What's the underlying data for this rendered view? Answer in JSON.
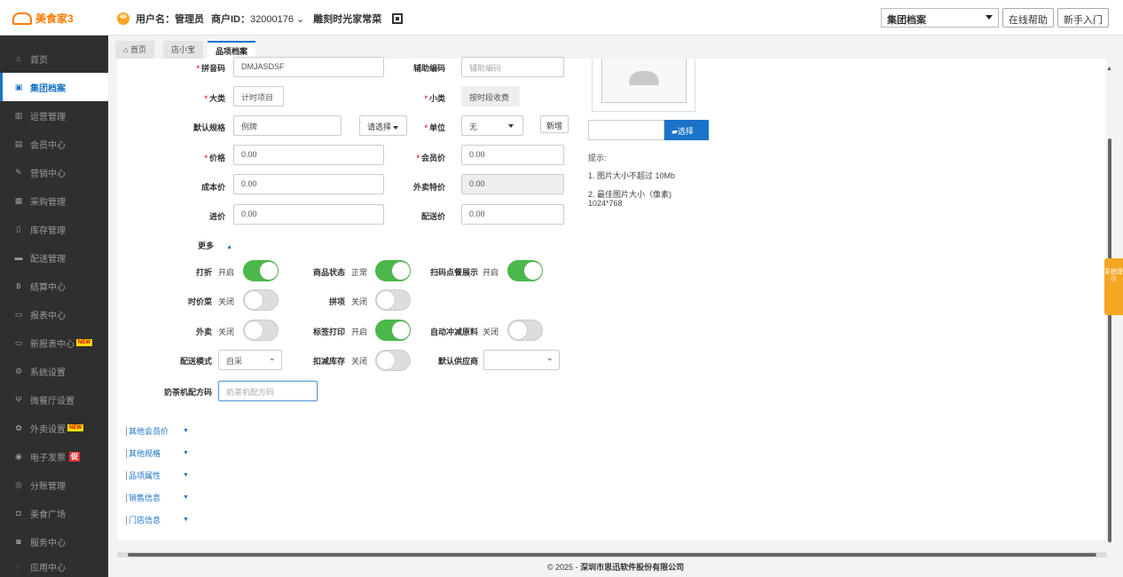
{
  "app": {
    "name": "美食家3"
  },
  "header": {
    "user_label": "用户名：",
    "user_name": "管理员",
    "merchant_label": "商户ID：",
    "merchant_id": "32000176",
    "store_name": "雕刻时光家常菜",
    "module_select": "集团档案",
    "help_button": "在线帮助",
    "guide_button": "新手入门",
    "icons": {
      "avatar": "user-icon",
      "qr": "qr-code-icon",
      "logo": "cloud-logo"
    }
  },
  "sidebar": {
    "items": [
      {
        "icon": "⌂",
        "label": "首页"
      },
      {
        "icon": "▣",
        "label": "集团档案",
        "active": true
      },
      {
        "icon": "▥",
        "label": "运营管理"
      },
      {
        "icon": "▤",
        "label": "会员中心"
      },
      {
        "icon": "✎",
        "label": "营销中心"
      },
      {
        "icon": "▦",
        "label": "采购管理"
      },
      {
        "icon": "▯",
        "label": "库存管理"
      },
      {
        "icon": "▬",
        "label": "配送管理"
      },
      {
        "icon": "฿",
        "label": "结算中心"
      },
      {
        "icon": "▭",
        "label": "报表中心"
      },
      {
        "icon": "▭",
        "label": "新报表中心",
        "badge": "NEW"
      },
      {
        "icon": "⚙",
        "label": "系统设置"
      },
      {
        "icon": "Ψ",
        "label": "微餐厅设置"
      },
      {
        "icon": "✿",
        "label": "外卖设置",
        "badge": "NEW"
      },
      {
        "icon": "◉",
        "label": "电子发票",
        "promo": "促"
      },
      {
        "icon": "◎",
        "label": "分账管理"
      },
      {
        "icon": "◘",
        "label": "美食广场"
      },
      {
        "icon": "◙",
        "label": "服务中心"
      },
      {
        "icon": "◌",
        "label": "应用中心"
      }
    ]
  },
  "tabs": [
    {
      "label": "首页",
      "icon": "⌂"
    },
    {
      "label": "店小宝"
    },
    {
      "label": "品项档案",
      "active": true
    }
  ],
  "form": {
    "pinyin": {
      "label": "拼音码",
      "value": "DMJASDSF"
    },
    "aux_code": {
      "label": "辅助编码",
      "placeholder": "辅助编码"
    },
    "category": {
      "label": "大类",
      "value": "计时项目"
    },
    "subcategory": {
      "label": "小类",
      "value": "按时段收费"
    },
    "default_spec": {
      "label": "默认规格",
      "value": "例牌",
      "select_button": "请选择"
    },
    "unit": {
      "label": "单位",
      "value": "无",
      "new_button": "新增"
    },
    "price": {
      "label": "价格",
      "value": "0.00"
    },
    "member_price": {
      "label": "会员价",
      "value": "0.00"
    },
    "cost_price": {
      "label": "成本价",
      "value": "0.00"
    },
    "takeout_price": {
      "label": "外卖特价",
      "value": "0.00"
    },
    "purchase_price": {
      "label": "进价",
      "value": "0.00"
    },
    "delivery_price": {
      "label": "配送价",
      "value": "0.00"
    },
    "more": {
      "label": "更多",
      "arrow": "▲"
    },
    "toggles": [
      {
        "label": "打折",
        "state": "开启",
        "on": true
      },
      {
        "label": "商品状态",
        "state": "正常",
        "on": true
      },
      {
        "label": "扫码点餐展示",
        "state": "开启",
        "on": true
      },
      {
        "label": "时价菜",
        "state": "关闭",
        "on": false
      },
      {
        "label": "拼项",
        "state": "关闭",
        "on": false
      },
      {
        "label": "外卖",
        "state": "关闭",
        "on": false
      },
      {
        "label": "标签打印",
        "state": "开启",
        "on": true
      },
      {
        "label": "自动冲减原料",
        "state": "关闭",
        "on": false
      },
      {
        "label": "扣减库存",
        "state": "关闭",
        "on": false
      }
    ],
    "delivery_mode": {
      "label": "配送模式",
      "value": "自采"
    },
    "default_supplier": {
      "label": "默认供应商",
      "value": ""
    },
    "milk_tea_code": {
      "label": "奶茶机配方码",
      "placeholder": "奶茶机配方码"
    }
  },
  "sections": [
    {
      "label": "其他会员价"
    },
    {
      "label": "其他规格"
    },
    {
      "label": "品项属性"
    },
    {
      "label": "销售信息"
    },
    {
      "label": "门店信息"
    }
  ],
  "image_upload": {
    "choose_button": "选择",
    "tips_title": "提示:",
    "tip1": "1. 图片大小不超过 10Mb",
    "tip2": "2. 最佳图片大小（像素)",
    "tip3": "1024*768"
  },
  "side_tab": {
    "label": "系统提示"
  },
  "footer": {
    "copyright": "© 2025 - ",
    "company": "深圳市思迅软件股份有限公司"
  }
}
